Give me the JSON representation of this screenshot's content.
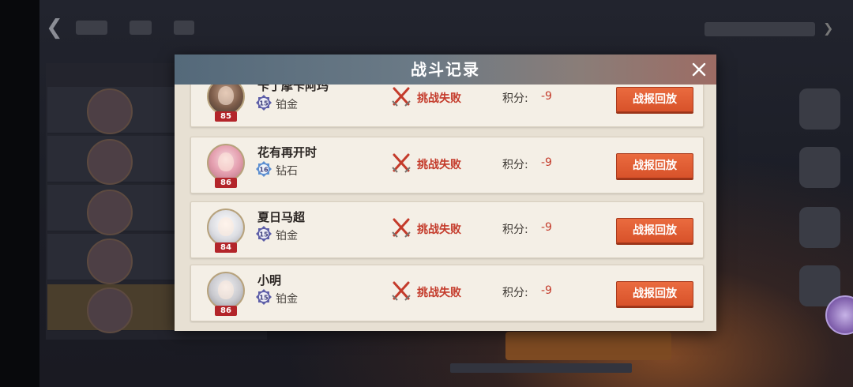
{
  "dialog": {
    "title": "战斗记录",
    "close_icon": "close-icon"
  },
  "records": [
    {
      "player_name": "卡丁摩卡阿玛",
      "level": "85",
      "rank_level": "15",
      "rank_name": "铂金",
      "result": "挑战失败",
      "score_label": "积分:",
      "score_value": "-9",
      "replay_label": "战报回放",
      "avatar_style": "brown"
    },
    {
      "player_name": "花有再开时",
      "level": "86",
      "rank_level": "16",
      "rank_name": "钻石",
      "result": "挑战失败",
      "score_label": "积分:",
      "score_value": "-9",
      "replay_label": "战报回放",
      "avatar_style": "pink"
    },
    {
      "player_name": "夏日马超",
      "level": "84",
      "rank_level": "15",
      "rank_name": "铂金",
      "result": "挑战失败",
      "score_label": "积分:",
      "score_value": "-9",
      "replay_label": "战报回放",
      "avatar_style": "white"
    },
    {
      "player_name": "小明",
      "level": "86",
      "rank_level": "15",
      "rank_name": "铂金",
      "result": "挑战失败",
      "score_label": "积分:",
      "score_value": "-9",
      "replay_label": "战报回放",
      "avatar_style": "grey"
    }
  ],
  "colors": {
    "accent_red": "#c43b2b",
    "button_orange": "#e0603a",
    "panel_bg": "#e7e0d3",
    "platinum_badge": "#5e5fa8",
    "diamond_badge": "#5d8fd1"
  }
}
